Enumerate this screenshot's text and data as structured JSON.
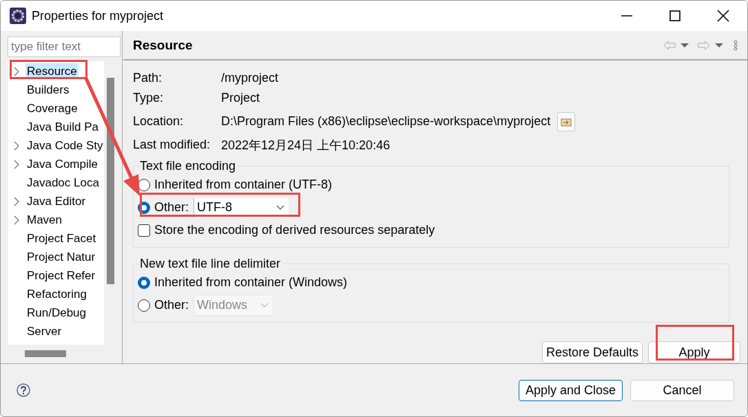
{
  "window": {
    "title": "Properties for myproject"
  },
  "filter": {
    "placeholder": "type filter text"
  },
  "tree": [
    {
      "label": "Resource",
      "expandable": true,
      "selected": true
    },
    {
      "label": "Builders",
      "expandable": false,
      "selected": false
    },
    {
      "label": "Coverage",
      "expandable": false,
      "selected": false
    },
    {
      "label": "Java Build Pa",
      "expandable": false,
      "selected": false
    },
    {
      "label": "Java Code Sty",
      "expandable": true,
      "selected": false
    },
    {
      "label": "Java Compile",
      "expandable": true,
      "selected": false
    },
    {
      "label": "Javadoc Loca",
      "expandable": false,
      "selected": false
    },
    {
      "label": "Java Editor",
      "expandable": true,
      "selected": false
    },
    {
      "label": "Maven",
      "expandable": true,
      "selected": false
    },
    {
      "label": "Project Facet",
      "expandable": false,
      "selected": false
    },
    {
      "label": "Project Natur",
      "expandable": false,
      "selected": false
    },
    {
      "label": "Project Refer",
      "expandable": false,
      "selected": false
    },
    {
      "label": "Refactoring",
      "expandable": false,
      "selected": false
    },
    {
      "label": "Run/Debug",
      "expandable": false,
      "selected": false
    },
    {
      "label": "Server",
      "expandable": false,
      "selected": false
    }
  ],
  "page": {
    "title": "Resource",
    "fields": [
      {
        "kind": "text",
        "label": "Path:",
        "value": "/myproject"
      },
      {
        "kind": "text",
        "label": "Type:",
        "value": "Project"
      },
      {
        "kind": "path",
        "label": "Location:",
        "value": "D:\\Program Files (x86)\\eclipse\\eclipse-workspace\\myproject"
      },
      {
        "kind": "text",
        "label": "Last modified:",
        "value": "2022年12月24日 上午10:20:46"
      }
    ]
  },
  "encoding": {
    "title": "Text file encoding",
    "options": [
      {
        "label": "Inherited from container (UTF-8)",
        "selected": false
      },
      {
        "label": "Other:",
        "selected": true,
        "value": "UTF-8",
        "disabled": false
      }
    ],
    "store_separately": {
      "label": "Store the encoding of derived resources separately",
      "checked": false
    }
  },
  "delimiter": {
    "title": "New text file line delimiter",
    "options": [
      {
        "label": "Inherited from container (Windows)",
        "selected": true
      },
      {
        "label": "Other:",
        "selected": false,
        "value": "Windows",
        "disabled": true
      }
    ]
  },
  "page_buttons": [
    "Restore Defaults",
    "Apply"
  ],
  "dialog_buttons": [
    {
      "label": "Apply and Close",
      "default": true
    },
    {
      "label": "Cancel",
      "default": false
    }
  ]
}
